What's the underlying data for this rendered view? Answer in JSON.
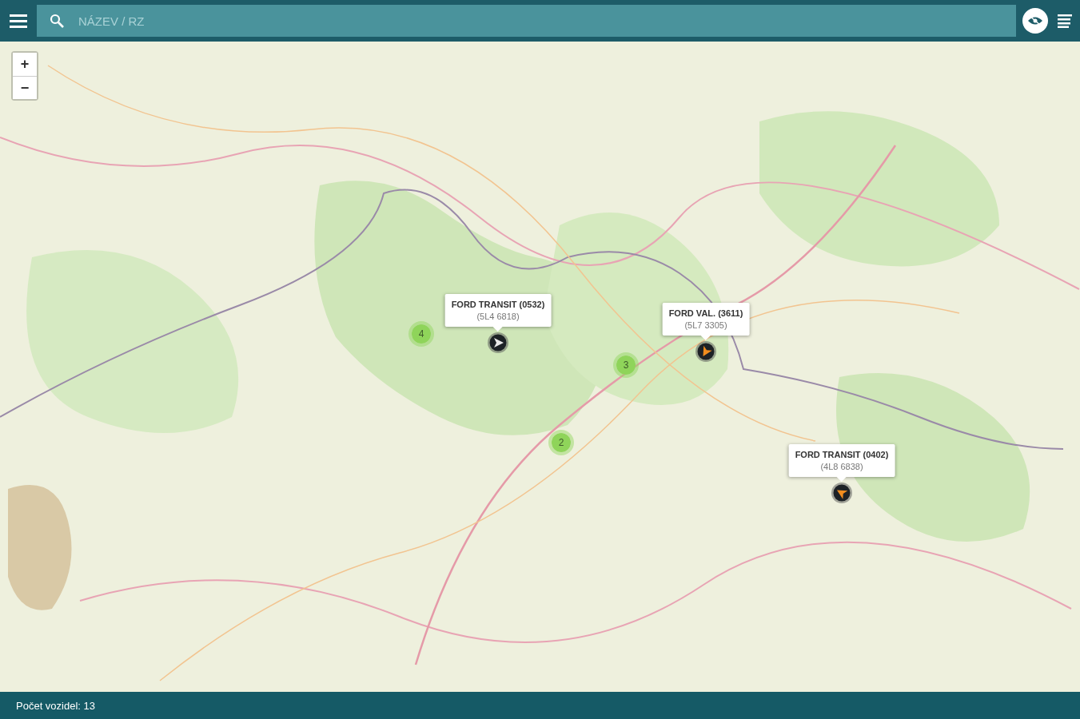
{
  "search": {
    "placeholder": "NÁZEV / RZ"
  },
  "zoom_controls": {
    "zoom_in": "+",
    "zoom_out": "−"
  },
  "clusters": [
    {
      "count": "4"
    },
    {
      "count": "3"
    },
    {
      "count": "2"
    }
  ],
  "vehicles": [
    {
      "name": "FORD TRANSIT (0532)",
      "plate": "(5L4 6818)",
      "color": "#e8e8e8"
    },
    {
      "name": "FORD VAL. (3611)",
      "plate": "(5L7 3305)",
      "color": "#f08c1e"
    },
    {
      "name": "FORD TRANSIT (0402)",
      "plate": "(4L8 6838)",
      "color": "#f08c1e"
    }
  ],
  "status_bar": {
    "text": "Počet vozidel: 13"
  }
}
